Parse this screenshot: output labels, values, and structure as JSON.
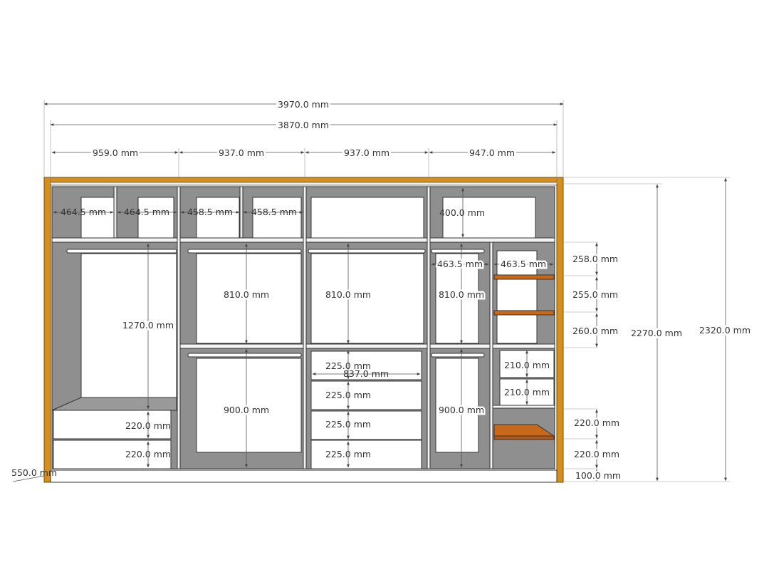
{
  "title": "",
  "colors": {
    "frame_wood": "#d4901c",
    "frame_wood_dark": "#b8741a",
    "interior_gray": "#8f8f8f",
    "interior_back": "#ffffff",
    "shelf_wood": "#c8681a",
    "line": "#333333"
  },
  "dimensions": {
    "overall_width": "3970.0 mm",
    "inner_width": "3870.0 mm",
    "bay_1_width": "959.0 mm",
    "bay_2_width": "937.0 mm",
    "bay_3_width": "937.0 mm",
    "bay_4_width": "947.0 mm",
    "top_1a": "464.5 mm",
    "top_1b": "464.5 mm",
    "top_2a": "458.5 mm",
    "top_2b": "458.5 mm",
    "top_4_height": "400.0 mm",
    "bay1_hang": "1270.0 mm",
    "bay1_drawer_1": "220.0 mm",
    "bay1_drawer_2": "220.0 mm",
    "bay2_hang_upper": "810.0 mm",
    "bay2_hang_lower": "900.0 mm",
    "bay3_hang": "810.0 mm",
    "bay3_drawer_width": "837.0 mm",
    "bay3_drawer_1": "225.0 mm",
    "bay3_drawer_2": "225.0 mm",
    "bay3_drawer_3": "225.0 mm",
    "bay3_drawer_4": "225.0 mm",
    "bay4_left_width": "463.5 mm",
    "bay4_right_width": "463.5 mm",
    "bay4_hang_upper": "810.0 mm",
    "bay4_hang_lower": "900.0 mm",
    "bay4_drawer_1": "210.0 mm",
    "bay4_drawer_2": "210.0 mm",
    "shelf_gap_1": "258.0 mm",
    "shelf_gap_2": "255.0 mm",
    "shelf_gap_3": "260.0 mm",
    "lower_gap_1": "220.0 mm",
    "lower_gap_2": "220.0 mm",
    "plinth": "100.0 mm",
    "inner_height": "2270.0 mm",
    "overall_height": "2320.0 mm",
    "depth": "550.0 mm"
  }
}
